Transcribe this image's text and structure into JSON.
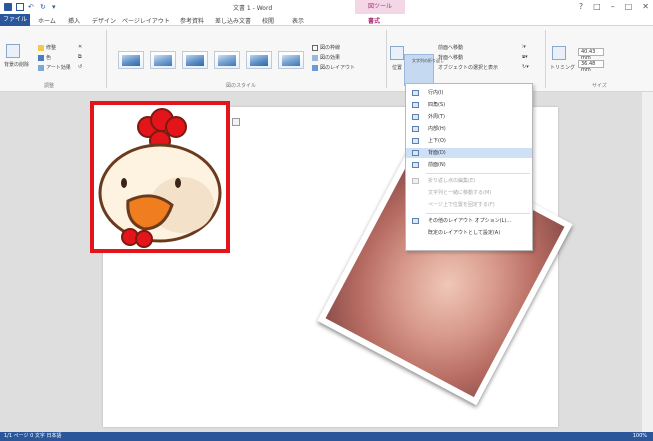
{
  "titlebar": {
    "doc_title": "文書 1 - Word",
    "context_group": "図ツール",
    "window_controls": [
      "?",
      "□",
      "–",
      "□",
      "✕"
    ]
  },
  "tabs": [
    {
      "label": "ファイル",
      "kind": "file"
    },
    {
      "label": "ホーム"
    },
    {
      "label": "挿入"
    },
    {
      "label": "デザイン"
    },
    {
      "label": "ページレイアウト"
    },
    {
      "label": "参考資料"
    },
    {
      "label": "差し込み文書"
    },
    {
      "label": "校閲"
    },
    {
      "label": "表示"
    },
    {
      "label": "書式",
      "active": true
    }
  ],
  "ribbon": {
    "adjust": {
      "label": "調整",
      "remove_bg": "背景の削除",
      "corrections": "修整",
      "color": "色",
      "artistic": "アート効果"
    },
    "styles": {
      "label": "図のスタイル",
      "border": "図の枠線",
      "effects": "図の効果",
      "layout": "図のレイアウト"
    },
    "arrange": {
      "position": "位置",
      "wrap_text": "文字列の折り返し",
      "bring_forward": "前面へ移動",
      "send_backward": "背面へ移動",
      "selection_pane": "オブジェクトの選択と表示"
    },
    "size": {
      "label": "サイズ",
      "crop": "トリミング",
      "height": "40.43 mm",
      "width": "36.48 mm"
    }
  },
  "wrap_menu": {
    "items": [
      {
        "label": "行内(I)"
      },
      {
        "label": "四角(S)"
      },
      {
        "label": "外周(T)"
      },
      {
        "label": "内部(H)"
      },
      {
        "label": "上下(O)"
      },
      {
        "label": "背面(D)",
        "highlight": true
      },
      {
        "label": "前面(N)"
      },
      {
        "label": "折り返し点の編集(E)",
        "disabled": true
      },
      {
        "label": "文字列と一緒に移動する(M)",
        "disabled": true
      },
      {
        "label": "ページ上で位置を固定する(F)",
        "disabled": true
      },
      {
        "label": "その他のレイアウト オプション(L)..."
      },
      {
        "label": "既定のレイアウトとして設定(A)"
      }
    ]
  },
  "statusbar": {
    "left": "1/1 ページ  0 文字  日本語",
    "right": "100%"
  },
  "colors": {
    "word_blue": "#2b579a",
    "accent_magenta": "#a62a6d",
    "frame_red": "#e4141b"
  }
}
